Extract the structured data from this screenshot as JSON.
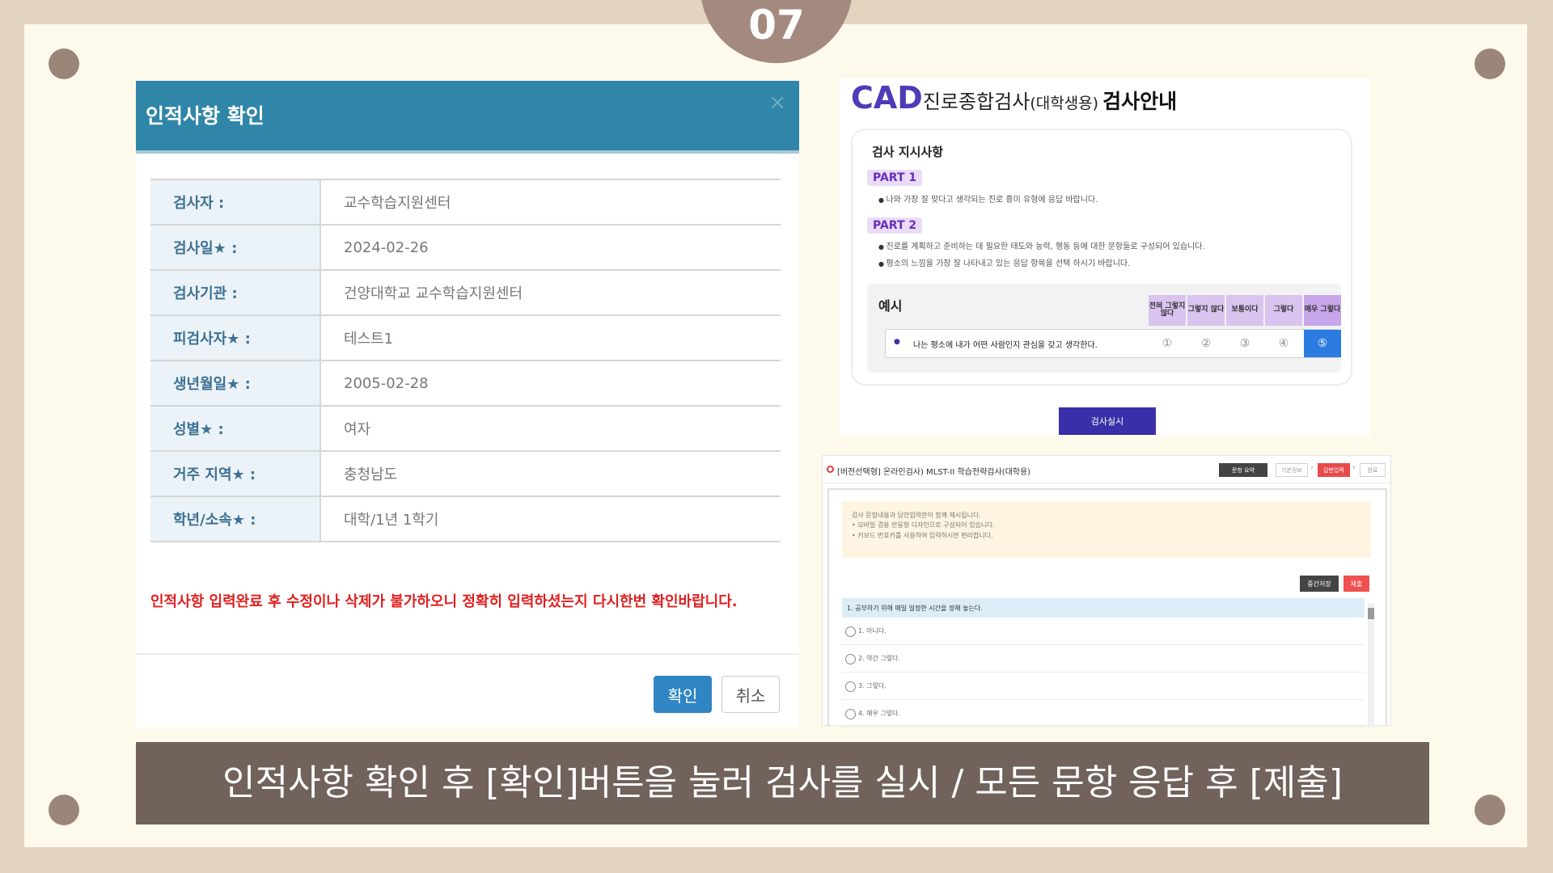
{
  "page_number": "07",
  "modal": {
    "title": "인적사항 확인",
    "close_icon": "×",
    "rows": [
      {
        "label": "검사자 :",
        "value": "교수학습지원센터"
      },
      {
        "label": "검사일★ :",
        "value": "2024-02-26"
      },
      {
        "label": "검사기관 :",
        "value": "건양대학교 교수학습지원센터"
      },
      {
        "label": "피검사자★ :",
        "value": "테스트1"
      },
      {
        "label": "생년월일★ :",
        "value": "2005-02-28"
      },
      {
        "label": "성별★ :",
        "value": "여자"
      },
      {
        "label": "거주 지역★ :",
        "value": "충청남도"
      },
      {
        "label": "학년/소속★ :",
        "value": "대학/1년 1학기"
      }
    ],
    "warning": "인적사항 입력완료 후 수정이나 삭제가 불가하오니 정확히 입력하셨는지 다시한번 확인바랍니다.",
    "confirm_label": "확인",
    "cancel_label": "취소"
  },
  "cad": {
    "brand": "CAD",
    "name": "진로종합검사",
    "sub": "(대학생용)",
    "guide": "검사안내",
    "heading": "검사 지시사항",
    "part1": "PART 1",
    "part1_items": [
      "나와 가장 잘 맞다고 생각되는 진로 흥미 유형에 응답 바랍니다."
    ],
    "part2": "PART 2",
    "part2_items": [
      "진로를 계획하고 준비하는 데 필요한 태도와 능력, 행동 등에 대한 문항들로 구성되어 있습니다.",
      "평소의 느낌을 가장 잘 나타내고 있는 응답 항목을 선택 하시기 바랍니다."
    ],
    "example_label": "예시",
    "scale": [
      "전혀 그렇지 않다",
      "그렇지 않다",
      "보통이다",
      "그렇다",
      "매우 그렇다"
    ],
    "example_text": "나는 평소에 내가 어떤 사람인지 관심을 갖고 생각한다.",
    "options": [
      "①",
      "②",
      "③",
      "④",
      "⑤"
    ],
    "selected_option": 5,
    "start_label": "검사실시"
  },
  "mlst": {
    "title": "[버전선택형] 온라인검사) MLST-II 학습전략검사(대학용)",
    "steps": [
      "문항 요약",
      "기본정보",
      "답변입력",
      "완료"
    ],
    "notice": [
      "검사 문항내용과 답안입력란이 함께 제시됩니다.",
      "• 모바일 겸용 반응형 디자인으로 구성되어 있습니다.",
      "• 키보드 번호키를 사용하여 입력하시면 편리합니다."
    ],
    "save_label": "중간저장",
    "submit_label": "제출",
    "question": "1. 공부하기 위해 매일 일정한 시간을 정해 놓는다.",
    "answers": [
      "1. 아니다.",
      "2. 약간 그렇다.",
      "3. 그렇다.",
      "4. 매우 그렇다."
    ]
  },
  "caption": "인적사항 확인 후 [확인]버튼을 눌러 검사를 실시 / 모든 문항 응답 후 [제출]"
}
